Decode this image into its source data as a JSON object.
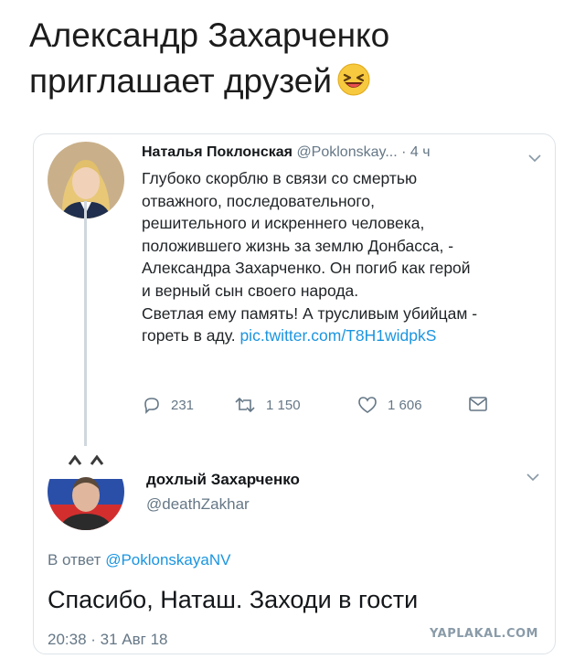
{
  "headline": {
    "line1": "Александр Захарченко",
    "line2": "приглашает друзей",
    "emoji": "laughing-face-emoji"
  },
  "tweet1": {
    "author_name": "Наталья Поклонская",
    "author_handle": "@Poklonskay...",
    "time": "· 4 ч",
    "text_lines": [
      "Глубоко скорблю в связи со смертью",
      "отважного, последовательного,",
      "решительного и искреннего человека,",
      "положившего жизнь за землю Донбасса, -",
      "Александра Захарченко. Он погиб как герой",
      "и верный сын своего народа.",
      "Светлая ему память! А трусливым убийцам -",
      "гореть в аду."
    ],
    "link": "pic.twitter.com/T8H1widpkS",
    "replies": "231",
    "retweets": "1 150",
    "likes": "1 606",
    "icons": [
      "reply-icon",
      "retweet-icon",
      "like-icon",
      "dm-icon"
    ]
  },
  "tweet2": {
    "author_name": "дохлый Захарченко",
    "author_handle": "@deathZakhar",
    "reply_prefix": "В ответ",
    "reply_handle": "@PoklonskayaNV",
    "text": "Спасибо, Наташ. Заходи в гости",
    "timestamp": "20:38 · 31 Авг 18"
  },
  "watermark": "YAPLAKAL.COM",
  "colors": {
    "link": "#1b95e0",
    "secondary_text": "#657786",
    "border": "#dde3e8"
  }
}
